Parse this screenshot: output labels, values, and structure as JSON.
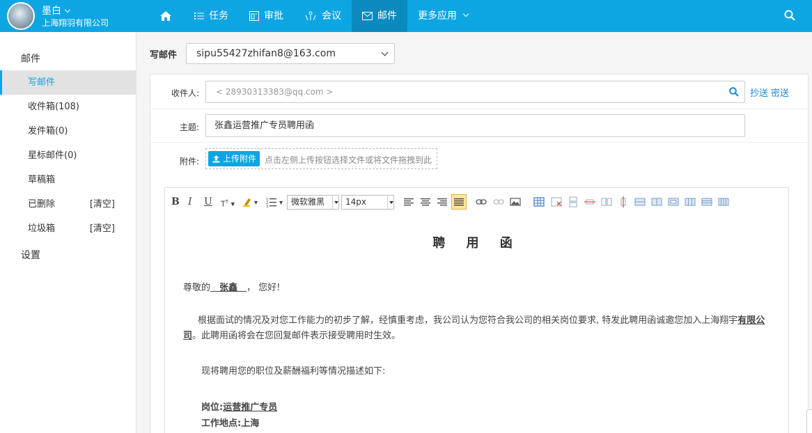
{
  "user": {
    "name": "墨白",
    "company": "上海翔羽有限公司"
  },
  "nav": [
    {
      "label": "",
      "icon": "home-icon"
    },
    {
      "label": "任务",
      "icon": "list-icon"
    },
    {
      "label": "审批",
      "icon": "approve-icon"
    },
    {
      "label": "会议",
      "icon": "meeting-icon"
    },
    {
      "label": "邮件",
      "icon": "mail-icon",
      "active": true
    },
    {
      "label": "更多应用",
      "icon": "chevron-down-icon"
    }
  ],
  "sidebar": {
    "title": "邮件",
    "items": [
      {
        "label": "写邮件",
        "active": true
      },
      {
        "label": "收件箱(108)"
      },
      {
        "label": "发件箱(0)"
      },
      {
        "label": "星标邮件(0)"
      },
      {
        "label": "草稿箱"
      },
      {
        "label": "已删除",
        "action": "[清空]"
      },
      {
        "label": "垃圾箱",
        "action": "[清空]"
      }
    ],
    "settings": "设置"
  },
  "compose": {
    "label": "写邮件",
    "from": "sipu55427zhifan8@163.com",
    "to_label": "收件人:",
    "to_value": "< 28930313383@qq.com >",
    "cc": "抄送",
    "bcc": "密送",
    "subject_label": "主题:",
    "subject": "张鑫运营推广专员聘用函",
    "attach_label": "附件:",
    "upload_button": "上传附件",
    "attach_hint": "点击左侧上传按钮选择文件或将文件拖拽到此"
  },
  "editor": {
    "font_family": "微软雅黑",
    "font_size": "14px",
    "doc": {
      "title": "聘 用 函",
      "greeting_pre": "尊敬的",
      "greeting_name": "　张鑫　",
      "greeting_post": "， 您好!",
      "para1_a": "根据面试的情况及对您工作能力的初步了解，经慎重考虑，我公司认为您符合我公司的相关岗位要求, 特发此聘用函诚邀您加入上海翔宇",
      "para1_b": "有限公司",
      "para1_c": "。此聘用函将会在您回复邮件表示接受聘用时生效。",
      "para2": "现将聘用您的职位及薪酬福利等情况描述如下:",
      "position_label": "岗位:",
      "position_value": "运营推广专员",
      "location_label": "工作地点:",
      "location_value": "上海"
    }
  }
}
